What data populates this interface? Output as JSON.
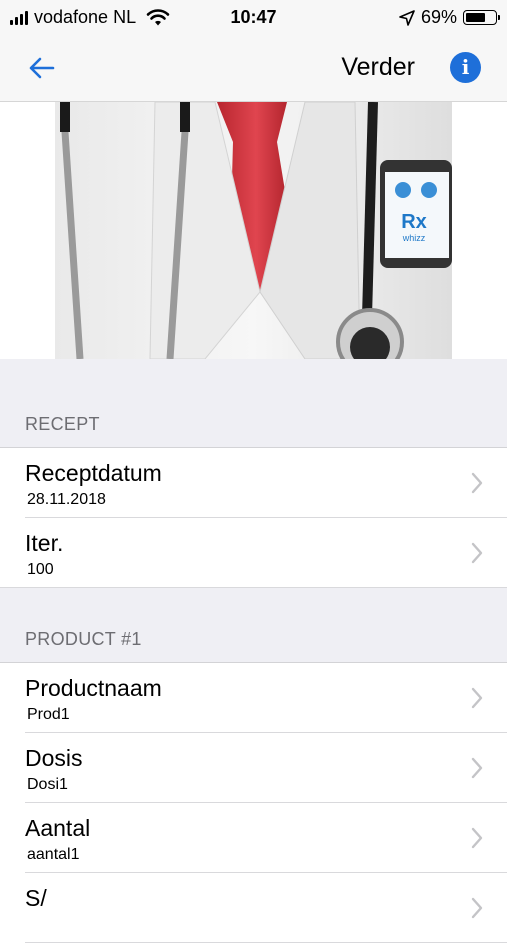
{
  "status_bar": {
    "carrier": "vodafone NL",
    "time": "10:47",
    "battery_percent": "69%",
    "battery_level": 0.69,
    "icons": [
      "signal-icon",
      "wifi-icon",
      "location-arrow-icon",
      "battery-icon"
    ]
  },
  "nav": {
    "back_icon": "arrow-left-icon",
    "title": "Verder",
    "info_icon": "info-icon",
    "accent_color": "#1e6fd9"
  },
  "hero": {
    "brand_text": "Rx",
    "brand_sub": "whizz"
  },
  "sections": [
    {
      "header": "RECEPT",
      "rows": [
        {
          "title": "Receptdatum",
          "value": "28.11.2018"
        },
        {
          "title": "Iter.",
          "value": "100"
        }
      ]
    },
    {
      "header": "PRODUCT #1",
      "rows": [
        {
          "title": "Productnaam",
          "value": "Prod1"
        },
        {
          "title": "Dosis",
          "value": "Dosi1"
        },
        {
          "title": "Aantal",
          "value": "aantal1"
        },
        {
          "title": "S/",
          "value": ""
        }
      ]
    }
  ]
}
